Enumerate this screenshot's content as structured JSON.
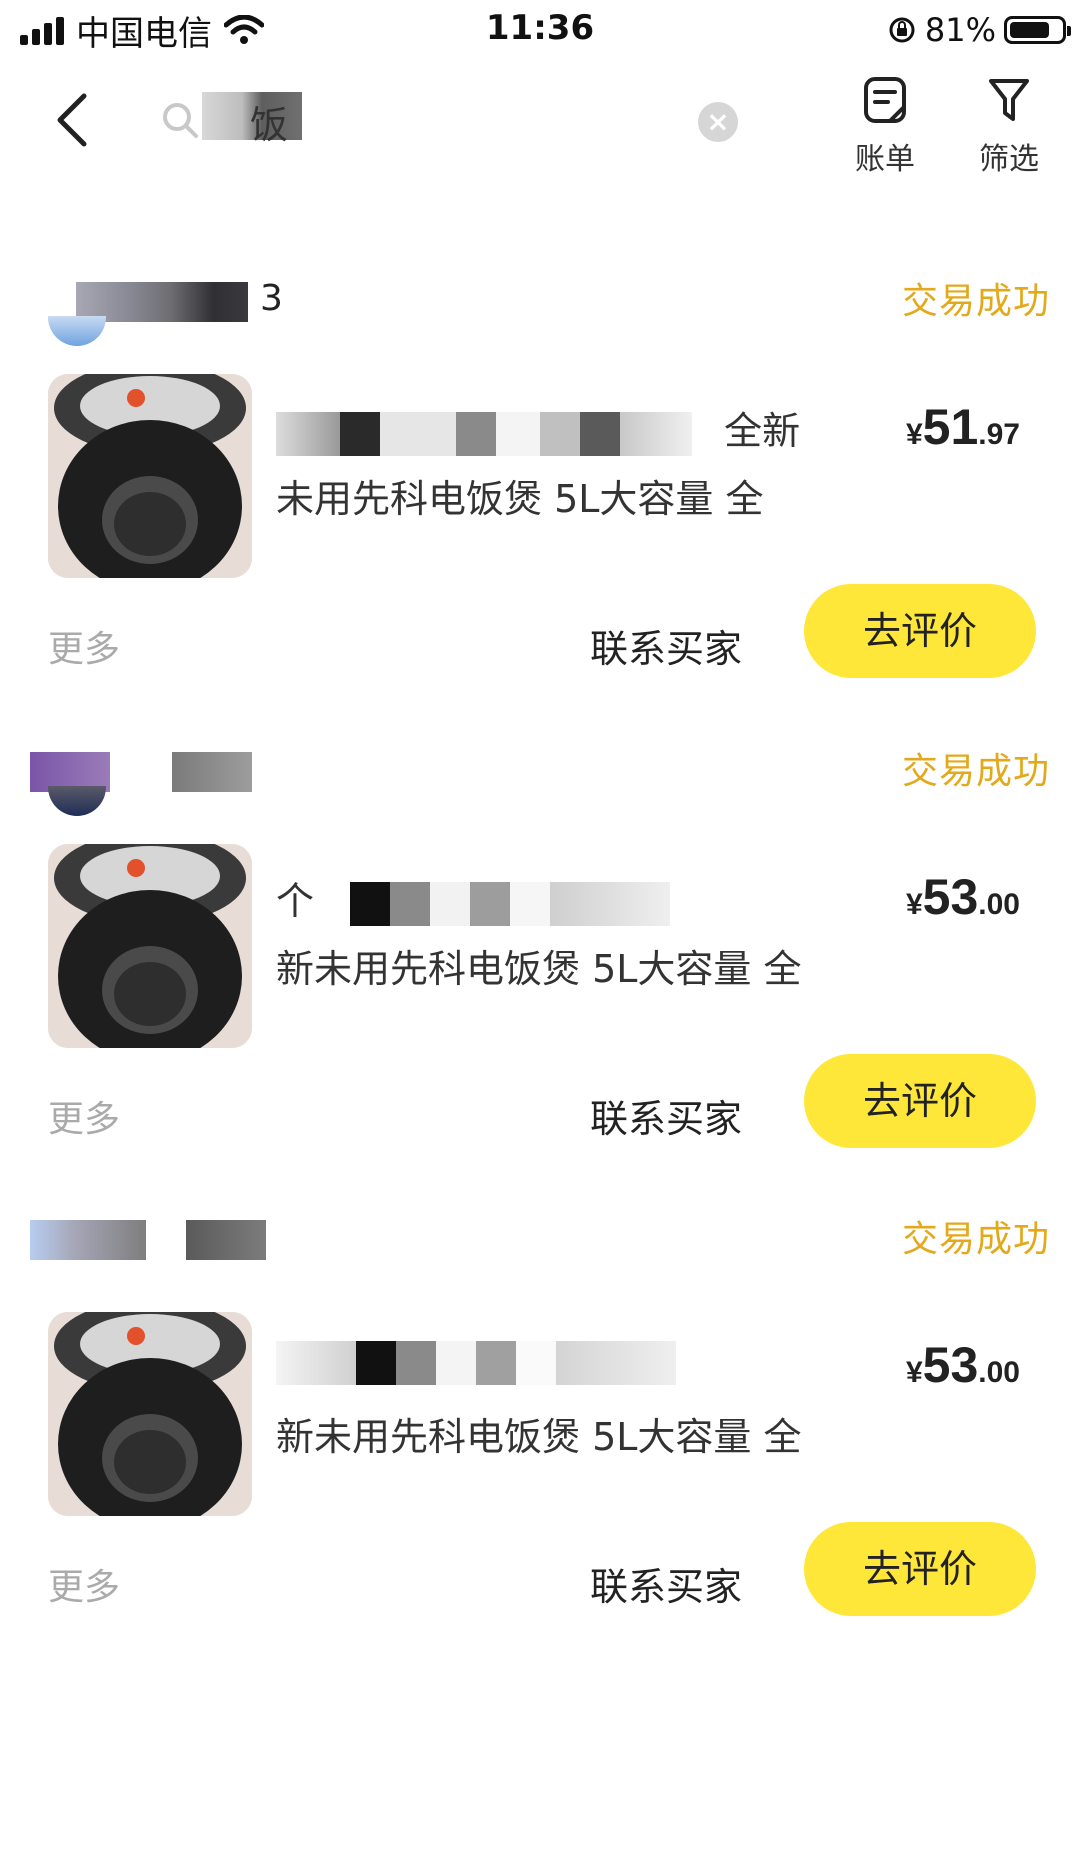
{
  "status_bar": {
    "carrier": "中国电信",
    "time": "11:36",
    "battery_text": "81%",
    "battery_level": 0.81
  },
  "nav": {
    "search_value": "饭",
    "actions": [
      {
        "label": "账单",
        "icon": "bill-icon"
      },
      {
        "label": "筛选",
        "icon": "filter-icon"
      }
    ]
  },
  "orders": [
    {
      "seller_name_suffix": "3",
      "status": "交易成功",
      "title_line1_visible": "全新",
      "title_line2": "未用先科电饭煲 5L大容量 全",
      "price_currency": "¥",
      "price_int": "51",
      "price_dec": ".97",
      "more_label": "更多",
      "contact_label": "联系买家",
      "review_label": "去评价"
    },
    {
      "seller_name_suffix": "",
      "status": "交易成功",
      "title_line1_visible": "个",
      "title_line2": "新未用先科电饭煲 5L大容量 全",
      "price_currency": "¥",
      "price_int": "53",
      "price_dec": ".00",
      "more_label": "更多",
      "contact_label": "联系买家",
      "review_label": "去评价"
    },
    {
      "seller_name_suffix": "",
      "status": "交易成功",
      "title_line1_visible": "",
      "title_line2": "新未用先科电饭煲 5L大容量 全",
      "price_currency": "¥",
      "price_int": "53",
      "price_dec": ".00",
      "more_label": "更多",
      "contact_label": "联系买家",
      "review_label": "去评价"
    }
  ],
  "colors": {
    "status_text": "#e3a91b",
    "review_button": "#ffe73a"
  }
}
